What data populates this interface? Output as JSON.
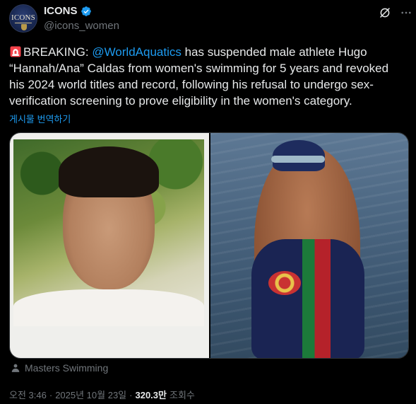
{
  "author": {
    "display_name": "ICONS",
    "handle": "@icons_women",
    "avatar_text": "ICONS",
    "verified": true
  },
  "post": {
    "emoji": "rotating-light-icon",
    "prefix": "BREAKING: ",
    "mention": "@WorldAquatics",
    "text": " has suspended male athlete Hugo “Hannah/Ana” Caldas from women's swimming for 5 years and revoked his 2024 world titles and record, following his refusal to undergo sex-verification screening to prove eligibility in the women's category.",
    "translate_label": "게시물 번역하기"
  },
  "media": {
    "left_photo": "portrait-photo",
    "right_photo": "swimmer-photo"
  },
  "context": {
    "icon": "person-icon",
    "label": "Masters Swimming"
  },
  "meta": {
    "time": "오전 3:46",
    "separator": "·",
    "date": "2025년 10월 23일",
    "views": "320.3만",
    "views_label": "조회수"
  },
  "colors": {
    "background": "#000000",
    "text": "#e7e9ea",
    "secondary": "#71767b",
    "accent": "#1d9bf0"
  }
}
